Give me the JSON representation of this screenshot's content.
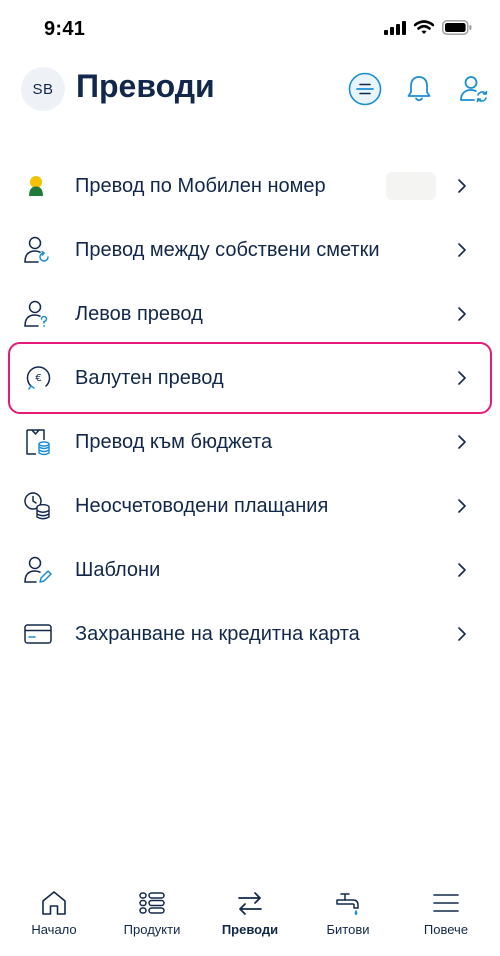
{
  "status": {
    "time": "9:41"
  },
  "header": {
    "avatar_initials": "SB",
    "title": "Преводи"
  },
  "menu": {
    "items": [
      {
        "label": "Превод по Мобилен номер"
      },
      {
        "label": "Превод между собствени сметки"
      },
      {
        "label": "Левов превод"
      },
      {
        "label": "Валутен превод"
      },
      {
        "label": "Превод към бюджета"
      },
      {
        "label": "Неосчетоводени плащания"
      },
      {
        "label": "Шаблони"
      },
      {
        "label": "Захранване на кредитна карта"
      }
    ]
  },
  "tabbar": {
    "items": [
      {
        "label": "Начало"
      },
      {
        "label": "Продукти"
      },
      {
        "label": "Преводи"
      },
      {
        "label": "Битови"
      },
      {
        "label": "Повече"
      }
    ],
    "active": "Преводи"
  },
  "colors": {
    "text": "#12284a",
    "accent": "#1a8fd6",
    "highlight": "#e6197a"
  }
}
